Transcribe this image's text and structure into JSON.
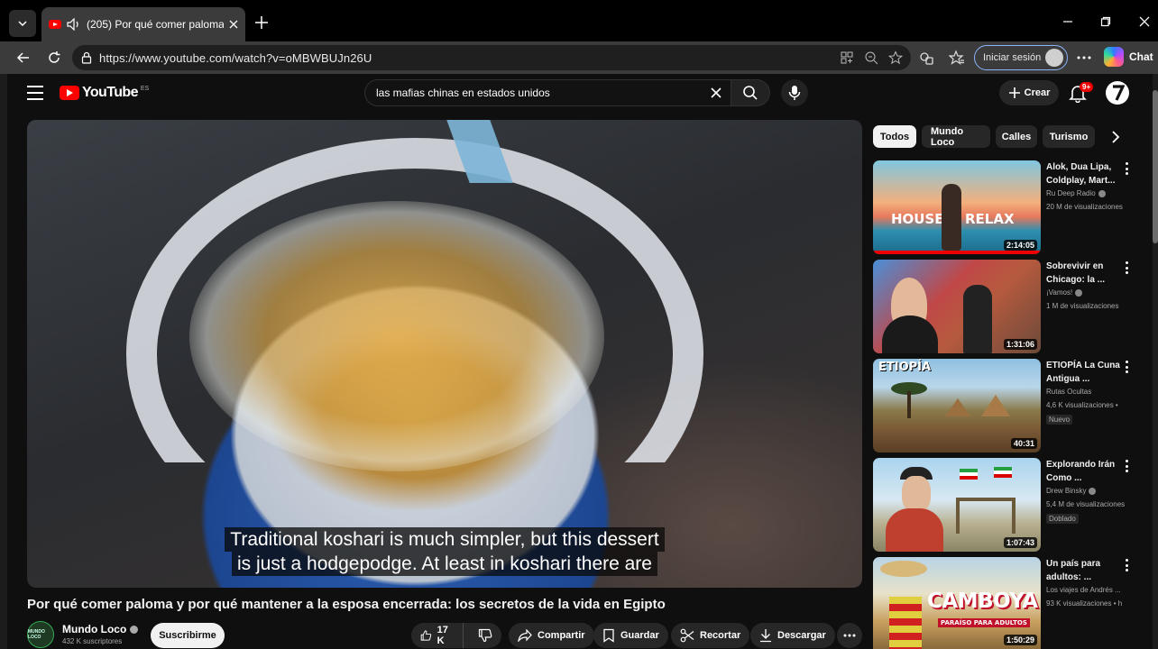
{
  "browser": {
    "tab_title": "(205) Por qué comer paloma y",
    "url": "https://www.youtube.com/watch?v=oMBWBUJn26U",
    "signin_label": "Iniciar sesión",
    "chat_label": "Chat"
  },
  "youtube": {
    "logo_text": "YouTube",
    "country": "ES",
    "search_query": "las mafias chinas en estados unidos",
    "create_label": "Crear",
    "notification_count": "9+"
  },
  "player": {
    "captions": [
      "Traditional koshari is much simpler, but this dessert",
      "is just a hodgepodge.  At least in koshari there are"
    ]
  },
  "video": {
    "title": "Por qué comer paloma y por qué mantener a la esposa encerrada: los secretos de la vida en Egipto",
    "channel": "Mundo Loco",
    "channel_avatar_text": "MUNDO LOCO",
    "subscribers": "432 K suscriptores",
    "subscribe_label": "Suscribirme",
    "likes": "17 K",
    "share_label": "Compartir",
    "save_label": "Guardar",
    "clip_label": "Recortar",
    "download_label": "Descargar"
  },
  "chips": [
    "Todos",
    "Mundo Loco",
    "Calles",
    "Turismo"
  ],
  "recommendations": [
    {
      "title": "Alok, Dua Lipa, Coldplay, Mart...",
      "channel": "Ru Deep Radio",
      "verified": true,
      "views": "20 M de visualizaciones",
      "duration": "2:14:05",
      "thumb_text_1": "HOUSE",
      "thumb_text_2": "RELAX"
    },
    {
      "title": "Sobrevivir en Chicago: la ...",
      "channel": "¡Vamos!",
      "verified": true,
      "views": "1 M de visualizaciones",
      "duration": "1:31:06"
    },
    {
      "title": "ETIOPÍA  La Cuna Antigua ...",
      "channel": "Rutas Ocultas",
      "views": "4,6 K visualizaciones • ",
      "badge": "Nuevo",
      "duration": "40:31",
      "thumb_text_1": "ETIOPÍA"
    },
    {
      "title": "Explorando Irán Como ...",
      "channel": "Drew Binsky",
      "verified": true,
      "views": "5,4 M de visualizaciones",
      "badge": "Doblado",
      "duration": "1:07:43"
    },
    {
      "title": "Un país para adultos: ...",
      "channel": "Los viajes de Andrés ...",
      "views": "93 K visualizaciones • h",
      "duration": "1:50:29",
      "thumb_text_1": "CAMBOYA",
      "thumb_text_2": "PARAÍSO PARA ADULTOS"
    }
  ]
}
